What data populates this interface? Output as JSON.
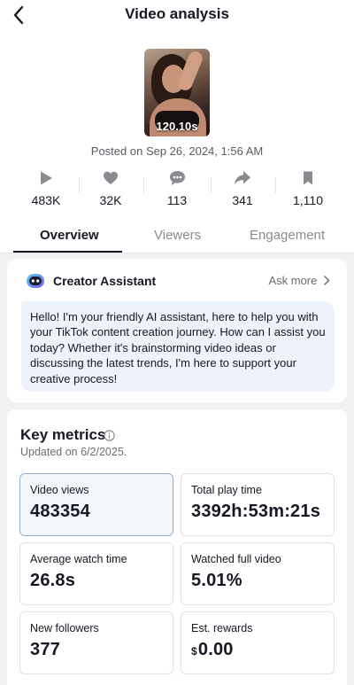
{
  "header": {
    "title": "Video analysis",
    "back_icon": "chevron-left-icon"
  },
  "video": {
    "duration": "120.10s",
    "posted": "Posted on Sep 26, 2024, 1:56 AM"
  },
  "stats": [
    {
      "icon": "play-icon",
      "value": "483K"
    },
    {
      "icon": "heart-icon",
      "value": "32K"
    },
    {
      "icon": "comment-icon",
      "value": "113"
    },
    {
      "icon": "share-icon",
      "value": "341"
    },
    {
      "icon": "bookmark-icon",
      "value": "1,110"
    }
  ],
  "tabs": [
    {
      "label": "Overview",
      "active": true
    },
    {
      "label": "Viewers",
      "active": false
    },
    {
      "label": "Engagement",
      "active": false
    }
  ],
  "assistant": {
    "name": "Creator Assistant",
    "ask_more": "Ask more",
    "message": "Hello! I'm your friendly AI assistant, here to help you with your TikTok content creation journey. How can I assist you today? Whether it's brainstorming video ideas or discussing the latest trends, I'm here to support your creative process!"
  },
  "key_metrics": {
    "title": "Key metrics",
    "updated": "Updated on 6/2/2025.",
    "items": [
      {
        "label": "Video views",
        "value": "483354",
        "selected": true
      },
      {
        "label": "Total play time",
        "value": "3392h:53m:21s",
        "selected": false
      },
      {
        "label": "Average watch time",
        "value": "26.8s",
        "selected": false
      },
      {
        "label": "Watched full video",
        "value": "5.01%",
        "selected": false
      },
      {
        "label": "New followers",
        "value": "377",
        "selected": false
      },
      {
        "label": "Est. rewards",
        "currency": "$",
        "value": "0.00",
        "selected": false
      }
    ]
  },
  "colors": {
    "accent": "#161823",
    "selected_card": "#f3f7fc",
    "bubble": "#edf2fb",
    "icon_gray": "#8a8b91"
  }
}
